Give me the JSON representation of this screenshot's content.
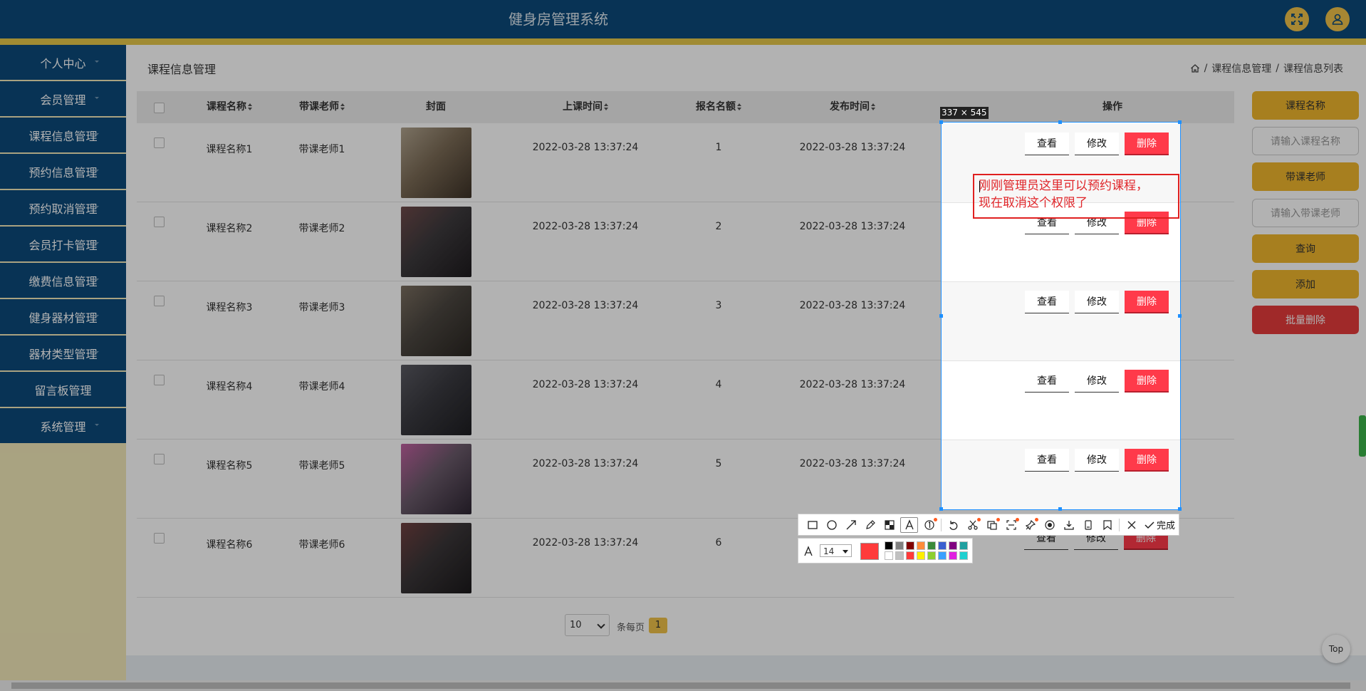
{
  "app": {
    "title": "健身房管理系统"
  },
  "topbar": {
    "fullscreen_icon": "fullscreen-icon",
    "user_icon": "user-icon"
  },
  "sidebar": {
    "items": [
      "个人中心",
      "会员管理",
      "课程信息管理",
      "预约信息管理",
      "预约取消管理",
      "会员打卡管理",
      "缴费信息管理",
      "健身器材管理",
      "器材类型管理",
      "留言板管理",
      "系统管理"
    ]
  },
  "page": {
    "title": "课程信息管理",
    "breadcrumb": [
      "课程信息管理",
      "课程信息列表"
    ],
    "breadcrumb_sep": "/"
  },
  "table": {
    "columns": [
      "课程名称",
      "带课老师",
      "封面",
      "上课时间",
      "报名名额",
      "发布时间",
      "操作"
    ],
    "rows": [
      {
        "name": "课程名称1",
        "teacher": "带课老师1",
        "class_time": "2022-03-28 13:37:24",
        "quota": "1",
        "publish_time": "2022-03-28 13:37:24"
      },
      {
        "name": "课程名称2",
        "teacher": "带课老师2",
        "class_time": "2022-03-28 13:37:24",
        "quota": "2",
        "publish_time": "2022-03-28 13:37:24"
      },
      {
        "name": "课程名称3",
        "teacher": "带课老师3",
        "class_time": "2022-03-28 13:37:24",
        "quota": "3",
        "publish_time": "2022-03-28 13:37:24"
      },
      {
        "name": "课程名称4",
        "teacher": "带课老师4",
        "class_time": "2022-03-28 13:37:24",
        "quota": "4",
        "publish_time": "2022-03-28 13:37:24"
      },
      {
        "name": "课程名称5",
        "teacher": "带课老师5",
        "class_time": "2022-03-28 13:37:24",
        "quota": "5",
        "publish_time": "2022-03-28 13:37:24"
      },
      {
        "name": "课程名称6",
        "teacher": "带课老师6",
        "class_time": "2022-03-28 13:37:24",
        "quota": "6",
        "publish_time": "2022-03-28 13:37:24"
      }
    ],
    "actions": {
      "view": "查看",
      "edit": "修改",
      "delete": "删除"
    }
  },
  "search_panel": {
    "course_label": "课程名称",
    "course_placeholder": "请输入课程名称",
    "teacher_label": "带课老师",
    "teacher_placeholder": "请输入带课老师",
    "query": "查询",
    "add": "添加",
    "batch_delete": "批量删除"
  },
  "pagination": {
    "page_size": "10",
    "per_page_label": "条每页",
    "current_page": "1"
  },
  "back_to_top": "Top",
  "capture_overlay": {
    "size_label": "337 × 545",
    "note_lines": [
      "刚刚管理员这里可以预约课程，",
      "现在取消这个权限了"
    ],
    "done_label": "完成",
    "font_size": "14",
    "current_color": "#ff3b3b",
    "palette": [
      "#000000",
      "#808080",
      "#800000",
      "#ff8c3a",
      "#3a8a3a",
      "#3a5fd0",
      "#800080",
      "#20a0a0",
      "#ffffff",
      "#c0c0c0",
      "#ff3b3b",
      "#ffee00",
      "#8ccf30",
      "#3aa0ff",
      "#e020e0",
      "#20d0d0"
    ],
    "tools": [
      "rectangle-icon",
      "ellipse-icon",
      "arrow-icon",
      "pencil-icon",
      "mosaic-icon",
      "text-icon",
      "serial-number-icon",
      "undo-icon",
      "scissors-icon",
      "ocr-icon",
      "scan-icon",
      "pin-icon",
      "record-icon",
      "download-icon",
      "copy-icon",
      "bookmark-icon",
      "close-icon"
    ]
  },
  "colors": {
    "topbar": "#0c4a7a",
    "accent": "#f0b62d",
    "danger": "#ff3a4a",
    "selection": "#1e90ff"
  }
}
